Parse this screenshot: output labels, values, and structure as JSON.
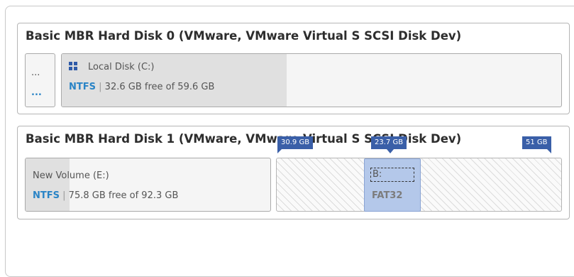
{
  "disks": [
    {
      "title": "Basic MBR Hard Disk 0 (VMware, VMware Virtual S SCSI Disk Dev)",
      "reserved": {
        "top": "...",
        "bottom": "..."
      },
      "partition": {
        "icon": "windows-icon",
        "label": "Local Disk (C:)",
        "fs": "NTFS",
        "sep": "|",
        "info": "32.6 GB free of 59.6 GB",
        "used_fraction": 0.45
      }
    },
    {
      "title": "Basic MBR Hard Disk 1 (VMware, VMware Virtual S SCSI Disk Dev)",
      "partition": {
        "label": "New Volume (E:)",
        "fs": "NTFS",
        "sep": "|",
        "info": "75.8 GB free of 92.3 GB",
        "used_fraction": 0.18
      },
      "unallocated_before": {
        "size": "30.9 GB"
      },
      "new_partition": {
        "label": "B:",
        "fs": "FAT32",
        "size": "23.7 GB"
      },
      "unallocated_after": {
        "size": "51 GB"
      }
    }
  ],
  "colors": {
    "accent": "#2a84c6",
    "tag": "#3a5fa8",
    "selected": "#b4c8ea"
  }
}
